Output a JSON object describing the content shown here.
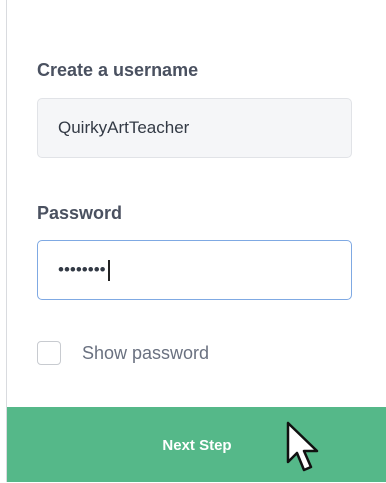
{
  "form": {
    "username_label": "Create a username",
    "username_value": "QuirkyArtTeacher",
    "password_label": "Password",
    "password_value": "••••••••",
    "show_password_label": "Show password",
    "show_password_checked": false,
    "next_button_label": "Next Step"
  },
  "colors": {
    "accent_green": "#55b889",
    "focus_blue": "#7fa9e3",
    "label_text": "#4a5160"
  },
  "icons": {
    "pointer": "mouse-pointer-icon"
  }
}
